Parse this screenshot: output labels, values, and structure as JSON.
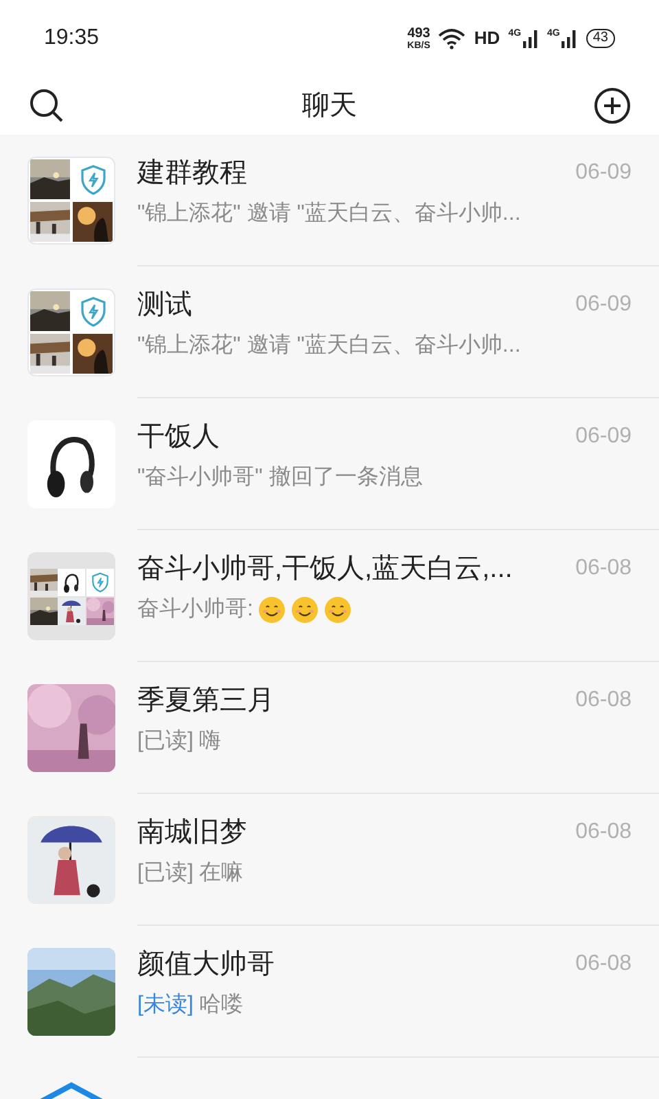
{
  "status_bar": {
    "time": "19:35",
    "speed": "493",
    "speed_unit": "KB/S",
    "hd": "HD",
    "network_1": "4G",
    "network_2": "4G",
    "battery": "43"
  },
  "header": {
    "title": "聊天"
  },
  "chats": [
    {
      "avatar": {
        "kind": "group4"
      },
      "title": "建群教程",
      "date": "06-09",
      "preview": {
        "text": "\"锦上添花\" 邀请 \"蓝天白云、奋斗小帅..."
      }
    },
    {
      "avatar": {
        "kind": "group4"
      },
      "title": "测试",
      "date": "06-09",
      "preview": {
        "text": "\"锦上添花\" 邀请 \"蓝天白云、奋斗小帅..."
      }
    },
    {
      "avatar": {
        "kind": "headphones"
      },
      "title": "干饭人",
      "date": "06-09",
      "preview": {
        "text": "\"奋斗小帅哥\" 撤回了一条消息"
      }
    },
    {
      "avatar": {
        "kind": "group9"
      },
      "title": "奋斗小帅哥,干饭人,蓝天白云,...",
      "date": "06-08",
      "preview": {
        "text": "奋斗小帅哥:",
        "emojis": [
          {
            "kind": "smile"
          },
          {
            "kind": "smile"
          },
          {
            "kind": "smile"
          }
        ]
      }
    },
    {
      "avatar": {
        "kind": "pink"
      },
      "title": "季夏第三月",
      "date": "06-08",
      "preview": {
        "tag": "[已读]",
        "unread": false,
        "text": "嗨"
      }
    },
    {
      "avatar": {
        "kind": "umbrella"
      },
      "title": "南城旧梦",
      "date": "06-08",
      "preview": {
        "tag": "[已读]",
        "unread": false,
        "text": "在嘛"
      }
    },
    {
      "avatar": {
        "kind": "mountain"
      },
      "title": "颜值大帅哥",
      "date": "06-08",
      "preview": {
        "tag": "[未读]",
        "unread": true,
        "text": "哈喽"
      }
    },
    {
      "avatar": {
        "kind": "shield"
      }
    }
  ]
}
